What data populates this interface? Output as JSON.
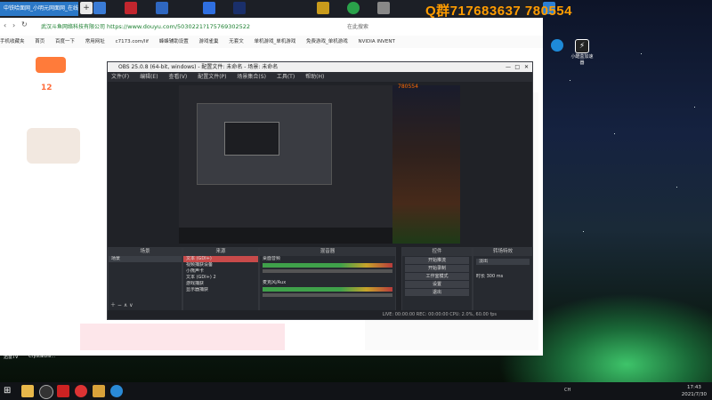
{
  "top_strip": {
    "tab_title": "中铁哈面网_小明元网面网_在线观看",
    "qq_label": "Q群717683637 780554"
  },
  "browser": {
    "url": "https://www.douyu.com/5030221?175769302522",
    "site_label": "武汉斗鱼网络科技有限公司",
    "search_placeholder": "在此搜索",
    "bookmarks": [
      "手机收藏夹",
      "首页",
      "百度一下",
      "常用网址",
      "c7173.com/lif",
      "蜂蜂辅助设置",
      "游戏雀巢",
      "无套文",
      "单机游戏_单机游戏",
      "免费游戏_单机游戏",
      "NVIDIA INVENT"
    ],
    "page_counter": "12"
  },
  "obs": {
    "title": "OBS 25.0.8 (64-bit, windows) - 配置文件: 未命名 - 场景: 未命名",
    "menu": [
      "文件(F)",
      "编辑(E)",
      "查看(V)",
      "配置文件(P)",
      "场景集合(S)",
      "工具(T)",
      "帮助(H)"
    ],
    "docks": {
      "scenes": {
        "header": "场景",
        "items": [
          "场景"
        ]
      },
      "sources": {
        "header": "来源",
        "items": [
          "文本 (GDI+)",
          "视频捕获设备",
          "小熊声卡",
          "文本 (GDI+) 2",
          "游戏捕获",
          "显示器捕获"
        ]
      },
      "mixer": {
        "header": "混音器",
        "items": [
          "桌面音频",
          "麦克风/Aux"
        ]
      },
      "transitions": {
        "header": "转场特效",
        "items": [
          "淡出",
          "时长 300 ms"
        ]
      },
      "controls": {
        "header": "控件",
        "buttons": [
          "开始推流",
          "开始录制",
          "工作室模式",
          "设置",
          "退出"
        ]
      }
    },
    "status": "LIVE: 00:00:00   REC: 00:00:00   CPU: 2.0%, 60.00 fps",
    "preview_overlay": "780554"
  },
  "desktop_icons": [
    {
      "label": "迅雷TV",
      "icon": "tv-icon"
    },
    {
      "label": "CrystalDis...",
      "icon": "disk-icon"
    },
    {
      "label": "小酷盒加速器",
      "icon": "lightning-icon"
    }
  ],
  "taskbar": {
    "time": "17:43",
    "date": "2021/7/30",
    "lang": "CH"
  }
}
